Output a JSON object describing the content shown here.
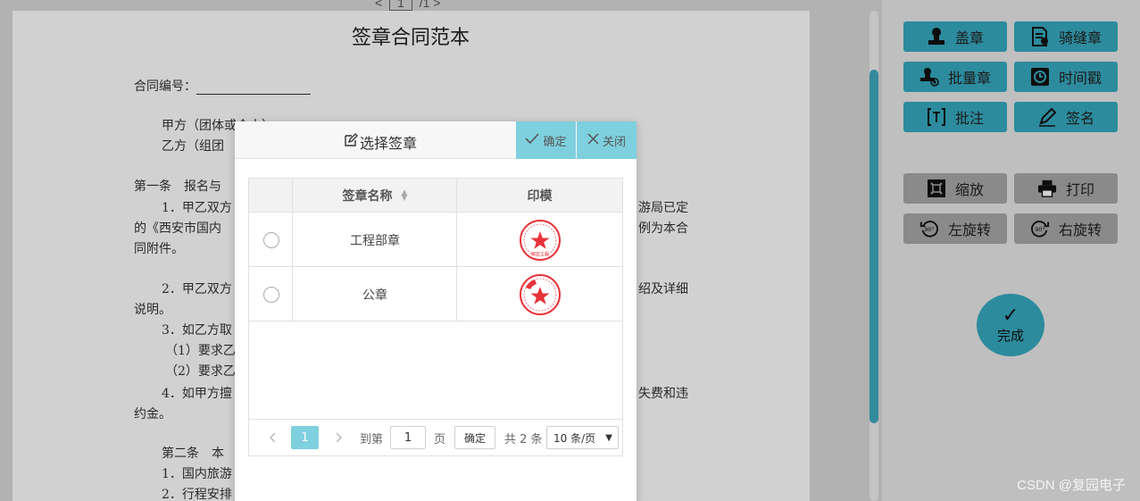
{
  "doc": {
    "pager": {
      "prev": "<",
      "page": "1",
      "suffix": "/1",
      "next": ">"
    },
    "title": "签章合同范本",
    "contract_no_label": "合同编号：",
    "lines": [
      "甲方（团体或个人）",
      "乙方（组团",
      "第一条　报名与",
      "1．甲乙双方",
      "的《西安市国内",
      "同附件。",
      "2．甲乙双方",
      "说明。",
      "3．如乙方取",
      "（1）要求乙",
      "（2）要求乙",
      "4．如甲方擅",
      "约金。",
      "第二条　本",
      "1．国内旅游",
      "2．行程安排"
    ],
    "right_fragments": [
      "游局已定",
      "例为本合",
      "绍及详细",
      "失费和违"
    ]
  },
  "tools": {
    "stamp": "盖章",
    "seam_stamp": "骑缝章",
    "batch_stamp": "批量章",
    "timestamp": "时间戳",
    "annotate": "批注",
    "sign": "签名",
    "zoom": "缩放",
    "print": "打印",
    "rotate_left": "左旋转",
    "rotate_right": "右旋转",
    "rotate_deg": "90°",
    "done": "完成"
  },
  "watermark": "CSDN @复园电子",
  "modal": {
    "title": "选择签章",
    "confirm": "确定",
    "close": "关闭",
    "columns": {
      "name": "签章名称",
      "seal": "印模"
    },
    "rows": [
      {
        "name": "工程部章",
        "seal_text": "西安工程"
      },
      {
        "name": "公章",
        "seal_text": ""
      }
    ],
    "pagination": {
      "current": "1",
      "goto_label": "到第",
      "goto_value": "1",
      "page_unit": "页",
      "go_button": "确定",
      "total": "共 2 条",
      "page_size": "10 条/页"
    }
  },
  "colors": {
    "accent": "#36aac0",
    "light_accent": "#7fd0de",
    "stamp_red": "#e8333a"
  }
}
